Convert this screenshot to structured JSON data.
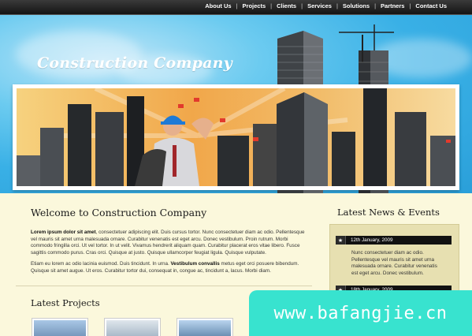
{
  "nav": {
    "items": [
      "About Us",
      "Projects",
      "Clients",
      "Services",
      "Solutions",
      "Partners",
      "Contact Us"
    ],
    "separator": "|"
  },
  "header": {
    "brand": "Construction Company"
  },
  "main": {
    "title": "Welcome to Construction Company",
    "para1_bold": "Lorem ipsum dolor sit amet",
    "para1": ", consectetuer adipiscing elit. Duis cursus tortor. Nunc consectetuer diam ac odio. Pellentesque vel mauris sit amet urna malesuada ornare. Curabitur venenatis est eget arcu. Donec vestibulum. Proin rutrum. Morbi commodo fringilla orci. Ut vel tortor. In ut velit. Vivamus hendrerit aliquam quam. Curabitur placerat eros vitae libero. Fusce sagittis commodo purus. Cras orci. Quisque at justo. Quisque ullamcorper feugiat ligula. Quisque vulputate.",
    "para2_a": "Etiam eu lorem ac odio lacinia euismod. Duis tincidunt. In urna. ",
    "para2_bold": "Vestibulum convallis",
    "para2_b": " metus eget orci posuere bibendum. Quisque sit amet augue. Ut eros. Curabitur tortor dui, consequat in, congue ac, tincidunt a, lacus. Morbi diam.",
    "projects_title": "Latest Projects"
  },
  "sidebar": {
    "title": "Latest News & Events",
    "news": [
      {
        "date": "12th January, 2009",
        "text": "Nunc consectetuer diam ac odio. Pellentesque vel mauris sit amet urna malesuada ornare. Curabitur venenatis est eget arcu. Donec vestibulum."
      },
      {
        "date": "18th January, 2009",
        "text": ""
      }
    ]
  },
  "watermark": "www.bafangjie.cn",
  "colors": {
    "sky": "#39b0e6",
    "topbar": "#1c1c1c",
    "page_bg": "#fbf8dc",
    "sidebar_bg": "#e7e0b1",
    "watermark": "#38e3cf"
  }
}
